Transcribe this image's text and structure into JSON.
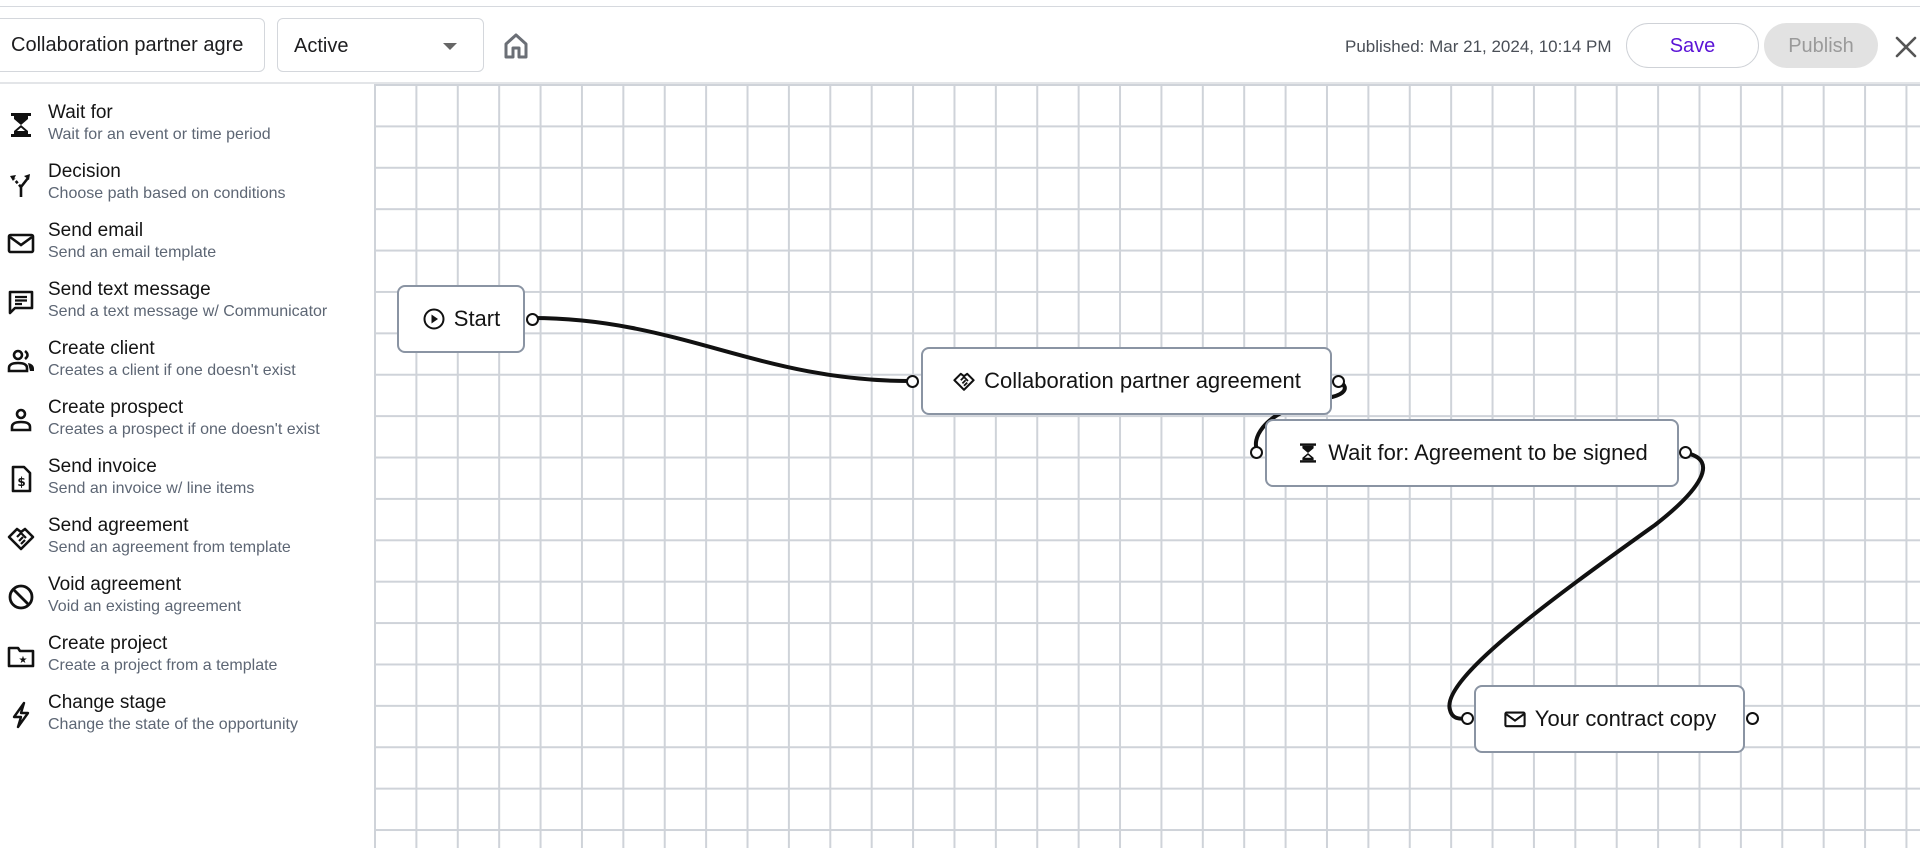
{
  "header": {
    "workflow_name": "Collaboration partner agre",
    "status": "Active",
    "home_icon": "home-icon",
    "published_text": "Published: Mar 21, 2024, 10:14 PM",
    "save_label": "Save",
    "publish_label": "Publish",
    "close_icon": "close-icon"
  },
  "sidebar": {
    "items": [
      {
        "icon": "hourglass-icon",
        "label": "Wait for",
        "description": "Wait for an event or time period"
      },
      {
        "icon": "split-arrows-icon",
        "label": "Decision",
        "description": "Choose path based on conditions"
      },
      {
        "icon": "envelope-icon",
        "label": "Send email",
        "description": "Send an email template"
      },
      {
        "icon": "chat-bubble-icon",
        "label": "Send text message",
        "description": "Send a text message w/ Communicator"
      },
      {
        "icon": "users-icon",
        "label": "Create client",
        "description": "Creates a client if one doesn't exist"
      },
      {
        "icon": "user-icon",
        "label": "Create prospect",
        "description": "Creates a prospect if one doesn't exist"
      },
      {
        "icon": "invoice-dollar-icon",
        "label": "Send invoice",
        "description": "Send an invoice w/ line items"
      },
      {
        "icon": "handshake-icon",
        "label": "Send agreement",
        "description": "Send an agreement from template"
      },
      {
        "icon": "ban-icon",
        "label": "Void agreement",
        "description": "Void an existing agreement"
      },
      {
        "icon": "folder-star-icon",
        "label": "Create project",
        "description": "Create a project from a template"
      },
      {
        "icon": "lightning-icon",
        "label": "Change stage",
        "description": "Change the state of the opportunity"
      }
    ]
  },
  "canvas": {
    "nodes": [
      {
        "id": "start",
        "icon": "play-circle-icon",
        "label": "Start"
      },
      {
        "id": "agreement",
        "icon": "handshake-icon",
        "label": "Collaboration partner agreement"
      },
      {
        "id": "wait",
        "icon": "hourglass-icon",
        "label": "Wait for: Agreement to be signed"
      },
      {
        "id": "email",
        "icon": "envelope-icon",
        "label": "Your contract copy"
      }
    ],
    "connections": [
      {
        "from": "start",
        "to": "agreement"
      },
      {
        "from": "agreement",
        "to": "wait"
      },
      {
        "from": "wait",
        "to": "email"
      }
    ]
  },
  "colors": {
    "accent": "#5b13d6",
    "node_border": "#8a94a3",
    "grid": "#cfd3d9",
    "disabled_button": "#e2e2e2"
  }
}
